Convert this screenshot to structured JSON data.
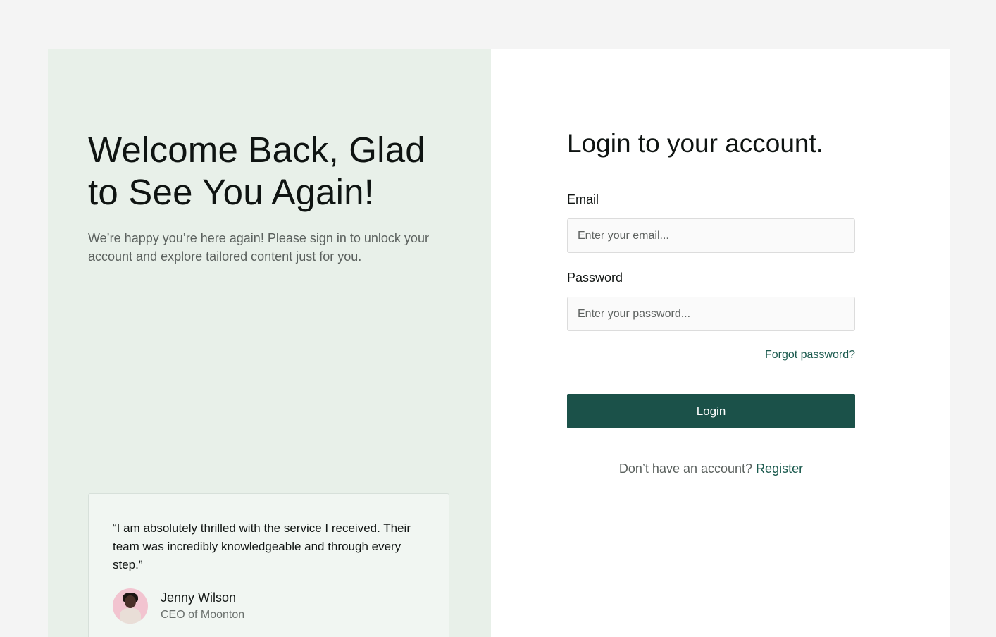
{
  "welcome": {
    "title": "Welcome Back, Glad to See You Again!",
    "subtitle": "We’re happy you’re here again! Please sign in to unlock your account and explore tailored content just for you."
  },
  "testimonial": {
    "quote": "“I am absolutely thrilled with the service I received. Their team was incredibly knowledgeable and through every step.”",
    "author_name": "Jenny Wilson",
    "author_role": "CEO of Moonton"
  },
  "login": {
    "title": "Login to your account.",
    "email_label": "Email",
    "email_placeholder": "Enter your email...",
    "password_label": "Password",
    "password_placeholder": "Enter your password...",
    "forgot_password": "Forgot password?",
    "button_label": "Login",
    "no_account_text": "Don’t have an account?",
    "register_link": "Register"
  },
  "colors": {
    "page_background": "#f4f4f4",
    "left_panel": "#e8f0e9",
    "accent": "#1b5149",
    "link": "#1b5a4e"
  },
  "icons": {
    "avatar": "user-avatar-photo"
  }
}
